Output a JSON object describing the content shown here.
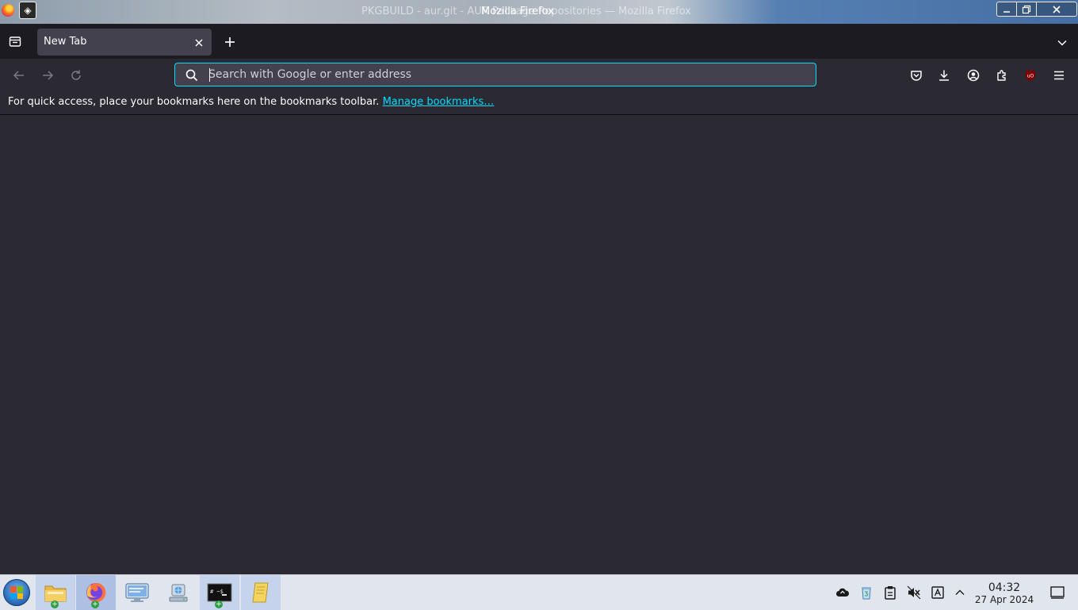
{
  "window": {
    "background_title": "PKGBUILD - aur.git - AUR Package Repositories — Mozilla Firefox",
    "title": "Mozilla Firefox"
  },
  "tabs": [
    {
      "label": "New Tab",
      "active": true
    }
  ],
  "urlbar": {
    "placeholder": "Search with Google or enter address",
    "value": ""
  },
  "bookmarks_toolbar": {
    "message": "For quick access, place your bookmarks here on the bookmarks toolbar.",
    "link_label": "Manage bookmarks…"
  },
  "toolbar_icons": [
    "pocket-icon",
    "downloads-icon",
    "account-icon",
    "extensions-icon",
    "ublock-origin-icon",
    "menu-icon"
  ],
  "taskbar": {
    "apps": [
      "file-manager-icon",
      "firefox-icon",
      "system-monitor-icon",
      "network-drive-icon",
      "terminal-icon",
      "notes-icon"
    ],
    "tray_icons": [
      "cloud-icon",
      "recycle-icon",
      "clipboard-icon",
      "muted-speaker-icon",
      "input-method-icon",
      "tray-expand-icon"
    ],
    "clock": {
      "time": "04:32",
      "date": "27 Apr 2024"
    }
  },
  "colors": {
    "toolbar_bg": "#2b2a33",
    "tabstrip_bg": "#1c1b22",
    "selected_tab_bg": "#42414d",
    "focus_ring": "#00ddff",
    "link": "#00ddff",
    "taskbar_bg": "#e1e6ee"
  }
}
